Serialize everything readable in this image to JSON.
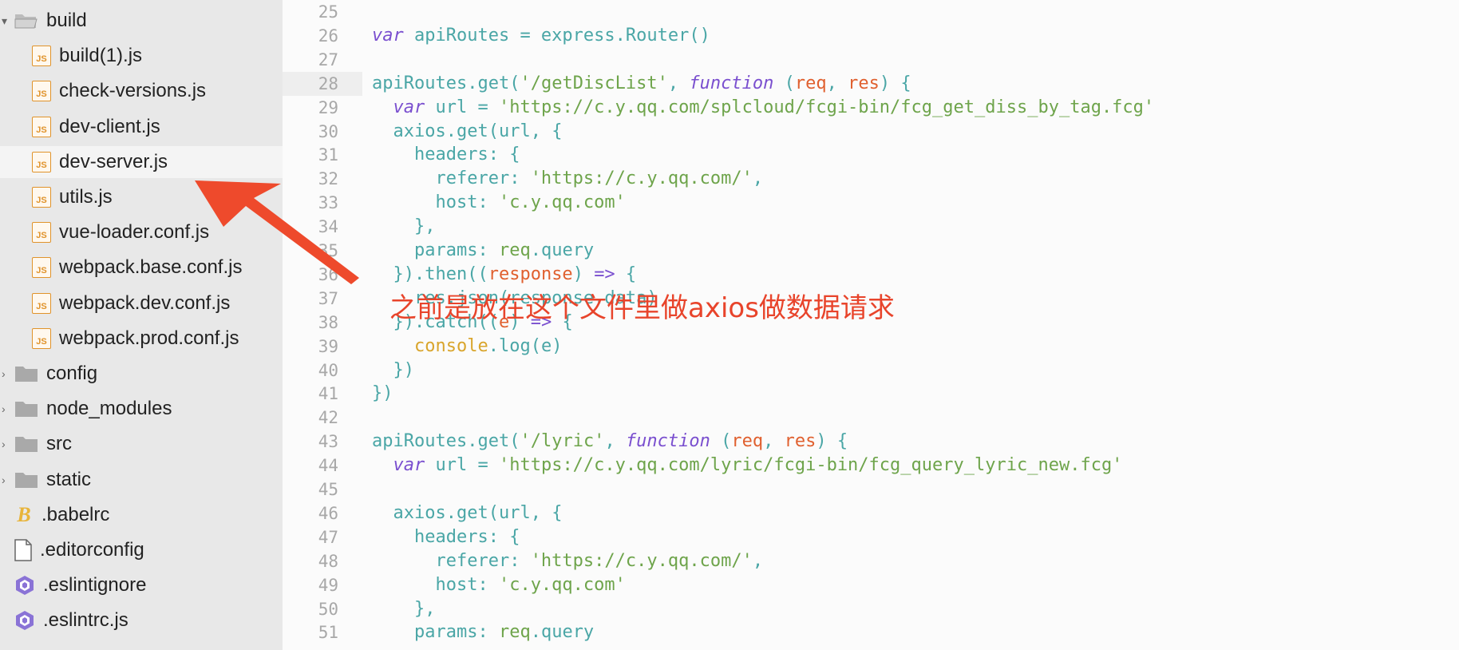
{
  "sidebar": {
    "rows": [
      {
        "label": "build",
        "type": "folder-open",
        "indent": 1,
        "toggle": "▾"
      },
      {
        "label": "build(1).js",
        "type": "js",
        "indent": 2
      },
      {
        "label": "check-versions.js",
        "type": "js",
        "indent": 2
      },
      {
        "label": "dev-client.js",
        "type": "js",
        "indent": 2
      },
      {
        "label": "dev-server.js",
        "type": "js",
        "indent": 2,
        "selected": true
      },
      {
        "label": "utils.js",
        "type": "js",
        "indent": 2
      },
      {
        "label": "vue-loader.conf.js",
        "type": "js",
        "indent": 2
      },
      {
        "label": "webpack.base.conf.js",
        "type": "js",
        "indent": 2
      },
      {
        "label": "webpack.dev.conf.js",
        "type": "js",
        "indent": 2
      },
      {
        "label": "webpack.prod.conf.js",
        "type": "js",
        "indent": 2
      },
      {
        "label": "config",
        "type": "folder",
        "indent": 1,
        "toggle": "›"
      },
      {
        "label": "node_modules",
        "type": "folder",
        "indent": 1,
        "toggle": "›"
      },
      {
        "label": "src",
        "type": "folder",
        "indent": 1,
        "toggle": "›"
      },
      {
        "label": "static",
        "type": "folder",
        "indent": 1,
        "toggle": "›"
      },
      {
        "label": ".babelrc",
        "type": "babel",
        "indent": 1
      },
      {
        "label": ".editorconfig",
        "type": "file",
        "indent": 1
      },
      {
        "label": ".eslintignore",
        "type": "eslint",
        "indent": 1
      },
      {
        "label": ".eslintrc.js",
        "type": "eslint",
        "indent": 1
      }
    ],
    "js_icon_text": "JS",
    "babel_icon_text": "B"
  },
  "editor": {
    "current_line": 28,
    "lines": [
      {
        "no": "25",
        "tokens": []
      },
      {
        "no": "26",
        "tokens": [
          [
            "kw",
            "var"
          ],
          [
            "plain",
            " apiRoutes = express"
          ],
          [
            "punc",
            "."
          ],
          [
            "plain",
            "Router"
          ],
          [
            "punc",
            "()"
          ]
        ]
      },
      {
        "no": "27",
        "tokens": []
      },
      {
        "no": "28",
        "tokens": [
          [
            "plain",
            "apiRoutes"
          ],
          [
            "punc",
            "."
          ],
          [
            "plain",
            "get"
          ],
          [
            "punc",
            "("
          ],
          [
            "str",
            "'/getDiscList'"
          ],
          [
            "punc",
            ", "
          ],
          [
            "kw",
            "function"
          ],
          [
            "punc",
            " ("
          ],
          [
            "param",
            "req"
          ],
          [
            "punc",
            ", "
          ],
          [
            "param",
            "res"
          ],
          [
            "punc",
            ") {"
          ]
        ]
      },
      {
        "no": "29",
        "tokens": [
          [
            "plain",
            "  "
          ],
          [
            "kw",
            "var"
          ],
          [
            "plain",
            " url = "
          ],
          [
            "str",
            "'https://c.y.qq.com/splcloud/fcgi-bin/fcg_get_diss_by_tag.fcg'"
          ]
        ]
      },
      {
        "no": "30",
        "tokens": [
          [
            "plain",
            "  axios"
          ],
          [
            "punc",
            "."
          ],
          [
            "plain",
            "get"
          ],
          [
            "punc",
            "("
          ],
          [
            "plain",
            "url"
          ],
          [
            "punc",
            ", {"
          ]
        ]
      },
      {
        "no": "31",
        "tokens": [
          [
            "plain",
            "    headers"
          ],
          [
            "punc",
            ": {"
          ]
        ]
      },
      {
        "no": "32",
        "tokens": [
          [
            "plain",
            "      referer"
          ],
          [
            "punc",
            ": "
          ],
          [
            "str",
            "'https://c.y.qq.com/'"
          ],
          [
            "punc",
            ","
          ]
        ]
      },
      {
        "no": "33",
        "tokens": [
          [
            "plain",
            "      host"
          ],
          [
            "punc",
            ": "
          ],
          [
            "str",
            "'c.y.qq.com'"
          ]
        ]
      },
      {
        "no": "34",
        "tokens": [
          [
            "punc",
            "    },"
          ]
        ]
      },
      {
        "no": "35",
        "tokens": [
          [
            "plain",
            "    params"
          ],
          [
            "punc",
            ": "
          ],
          [
            "str",
            "req"
          ],
          [
            "punc",
            "."
          ],
          [
            "plain",
            "query"
          ]
        ]
      },
      {
        "no": "36",
        "tokens": [
          [
            "punc",
            "  })."
          ],
          [
            "plain",
            "then"
          ],
          [
            "punc",
            "(("
          ],
          [
            "param",
            "response"
          ],
          [
            "punc",
            ") "
          ],
          [
            "arrow",
            "=>"
          ],
          [
            "punc",
            " {"
          ]
        ]
      },
      {
        "no": "37",
        "tokens": [
          [
            "plain",
            "    res"
          ],
          [
            "punc",
            "."
          ],
          [
            "plain",
            "json"
          ],
          [
            "punc",
            "("
          ],
          [
            "plain",
            "response"
          ],
          [
            "punc",
            "."
          ],
          [
            "plain",
            "data"
          ],
          [
            "punc",
            ")"
          ]
        ]
      },
      {
        "no": "38",
        "tokens": [
          [
            "punc",
            "  })."
          ],
          [
            "plain",
            "catch"
          ],
          [
            "punc",
            "(("
          ],
          [
            "param",
            "e"
          ],
          [
            "punc",
            ") "
          ],
          [
            "arrow",
            "=>"
          ],
          [
            "punc",
            " {"
          ]
        ]
      },
      {
        "no": "39",
        "tokens": [
          [
            "console",
            "    console"
          ],
          [
            "punc",
            "."
          ],
          [
            "plain",
            "log"
          ],
          [
            "punc",
            "("
          ],
          [
            "plain",
            "e"
          ],
          [
            "punc",
            ")"
          ]
        ]
      },
      {
        "no": "40",
        "tokens": [
          [
            "punc",
            "  })"
          ]
        ]
      },
      {
        "no": "41",
        "tokens": [
          [
            "punc",
            "})"
          ]
        ]
      },
      {
        "no": "42",
        "tokens": []
      },
      {
        "no": "43",
        "tokens": [
          [
            "plain",
            "apiRoutes"
          ],
          [
            "punc",
            "."
          ],
          [
            "plain",
            "get"
          ],
          [
            "punc",
            "("
          ],
          [
            "str",
            "'/lyric'"
          ],
          [
            "punc",
            ", "
          ],
          [
            "kw",
            "function"
          ],
          [
            "punc",
            " ("
          ],
          [
            "param",
            "req"
          ],
          [
            "punc",
            ", "
          ],
          [
            "param",
            "res"
          ],
          [
            "punc",
            ") {"
          ]
        ]
      },
      {
        "no": "44",
        "tokens": [
          [
            "plain",
            "  "
          ],
          [
            "kw",
            "var"
          ],
          [
            "plain",
            " url = "
          ],
          [
            "str",
            "'https://c.y.qq.com/lyric/fcgi-bin/fcg_query_lyric_new.fcg'"
          ]
        ]
      },
      {
        "no": "45",
        "tokens": []
      },
      {
        "no": "46",
        "tokens": [
          [
            "plain",
            "  axios"
          ],
          [
            "punc",
            "."
          ],
          [
            "plain",
            "get"
          ],
          [
            "punc",
            "("
          ],
          [
            "plain",
            "url"
          ],
          [
            "punc",
            ", {"
          ]
        ]
      },
      {
        "no": "47",
        "tokens": [
          [
            "plain",
            "    headers"
          ],
          [
            "punc",
            ": {"
          ]
        ]
      },
      {
        "no": "48",
        "tokens": [
          [
            "plain",
            "      referer"
          ],
          [
            "punc",
            ": "
          ],
          [
            "str",
            "'https://c.y.qq.com/'"
          ],
          [
            "punc",
            ","
          ]
        ]
      },
      {
        "no": "49",
        "tokens": [
          [
            "plain",
            "      host"
          ],
          [
            "punc",
            ": "
          ],
          [
            "str",
            "'c.y.qq.com'"
          ]
        ]
      },
      {
        "no": "50",
        "tokens": [
          [
            "punc",
            "    },"
          ]
        ]
      },
      {
        "no": "51",
        "tokens": [
          [
            "plain",
            "    params"
          ],
          [
            "punc",
            ": "
          ],
          [
            "str",
            "req"
          ],
          [
            "punc",
            "."
          ],
          [
            "plain",
            "query"
          ]
        ]
      }
    ]
  },
  "annotation": {
    "text": "之前是放在这个文件里做axios做数据请求",
    "color": "#e8442b"
  }
}
